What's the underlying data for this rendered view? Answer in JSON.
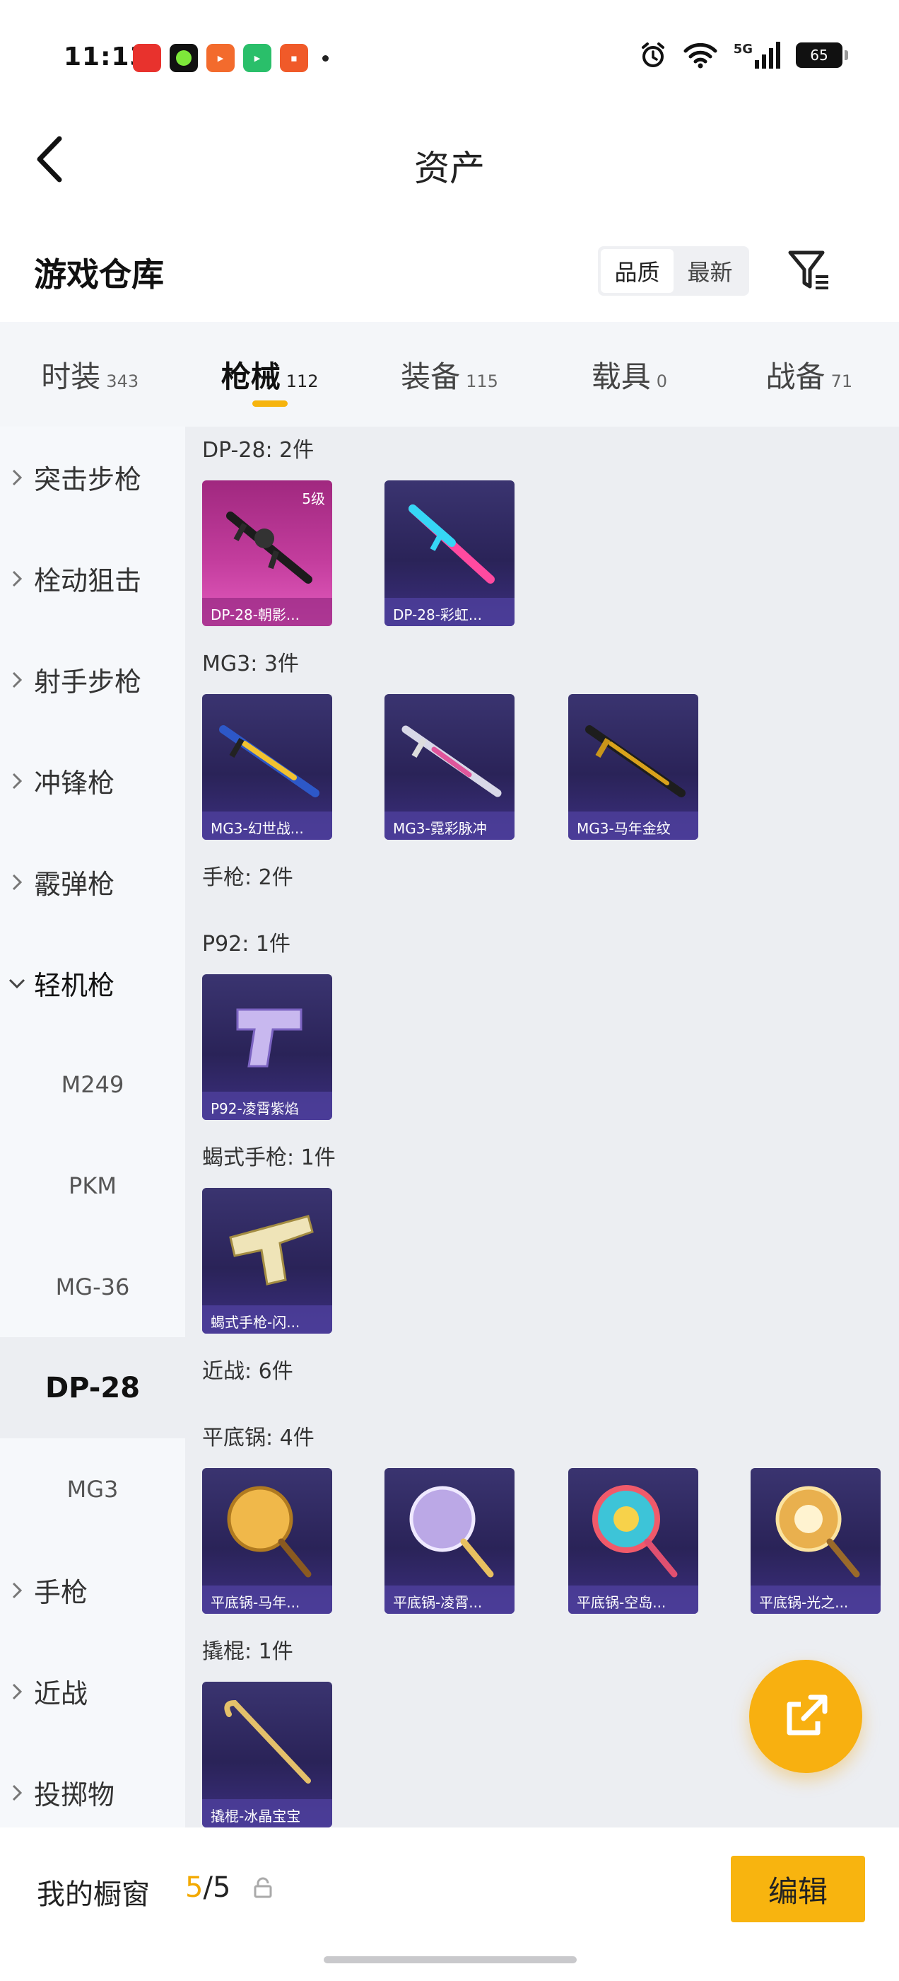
{
  "status_bar": {
    "time": "11:13",
    "network": "5G",
    "battery": "65",
    "app_icons": [
      "xiaohongshu-app-icon",
      "lime-app-icon",
      "video-app-icon",
      "play-app-icon",
      "store-app-icon"
    ]
  },
  "header": {
    "title": "资产"
  },
  "section": {
    "title": "游戏仓库",
    "sort_options": [
      "品质",
      "最新"
    ],
    "active_sort": "品质"
  },
  "tabs": [
    {
      "label": "时装",
      "count": "343"
    },
    {
      "label": "枪械",
      "count": "112",
      "active": true
    },
    {
      "label": "装备",
      "count": "115"
    },
    {
      "label": "载具",
      "count": "0"
    },
    {
      "label": "战备",
      "count": "71"
    }
  ],
  "sidebar": [
    {
      "label": "突击步枪",
      "type": "collapsed"
    },
    {
      "label": "栓动狙击",
      "type": "collapsed"
    },
    {
      "label": "射手步枪",
      "type": "collapsed"
    },
    {
      "label": "冲锋枪",
      "type": "collapsed"
    },
    {
      "label": "霰弹枪",
      "type": "collapsed"
    },
    {
      "label": "轻机枪",
      "type": "expanded"
    },
    {
      "label": "M249",
      "type": "sub"
    },
    {
      "label": "PKM",
      "type": "sub"
    },
    {
      "label": "MG-36",
      "type": "sub"
    },
    {
      "label": "DP-28",
      "type": "sub",
      "selected": true
    },
    {
      "label": "MG3",
      "type": "sub"
    },
    {
      "label": "手枪",
      "type": "collapsed"
    },
    {
      "label": "近战",
      "type": "collapsed"
    },
    {
      "label": "投掷物",
      "type": "collapsed"
    }
  ],
  "groups": [
    {
      "title": "DP-28: 2件",
      "items": [
        {
          "caption": "DP-28-朝影...",
          "level": "5级",
          "style": "pink"
        },
        {
          "caption": "DP-28-彩虹...",
          "style": "purple"
        }
      ]
    },
    {
      "title": "MG3: 3件",
      "items": [
        {
          "caption": "MG3-幻世战...",
          "style": "purple"
        },
        {
          "caption": "MG3-霓彩脉冲",
          "style": "purple"
        },
        {
          "caption": "MG3-马年金纹",
          "style": "purple"
        }
      ]
    },
    {
      "title": "手枪: 2件",
      "items": []
    },
    {
      "title": "P92: 1件",
      "items": [
        {
          "caption": "P92-凌霄紫焰",
          "style": "purple"
        }
      ]
    },
    {
      "title": "蝎式手枪: 1件",
      "items": [
        {
          "caption": "蝎式手枪-闪...",
          "style": "purple"
        }
      ]
    },
    {
      "title": "近战: 6件",
      "items": []
    },
    {
      "title": "平底锅: 4件",
      "items": [
        {
          "caption": "平底锅-马年...",
          "style": "purple"
        },
        {
          "caption": "平底锅-凌霄...",
          "style": "purple"
        },
        {
          "caption": "平底锅-空岛...",
          "style": "purple"
        },
        {
          "caption": "平底锅-光之...",
          "style": "purple"
        }
      ]
    },
    {
      "title": "撬棍: 1件",
      "items": [
        {
          "caption": "撬棍-冰晶宝宝",
          "style": "purple"
        }
      ]
    }
  ],
  "bottom_bar": {
    "label": "我的橱窗",
    "used": "5",
    "total": "5",
    "edit_label": "编辑"
  },
  "colors": {
    "accent": "#f8b40f",
    "card_purple": "#2f2960",
    "card_pink": "#c33d9d"
  }
}
